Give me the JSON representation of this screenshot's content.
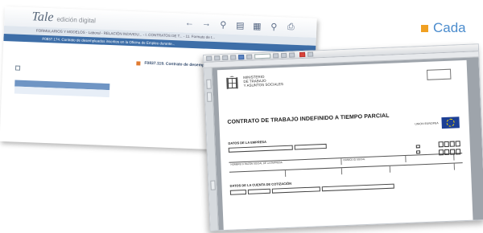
{
  "caption": {
    "text": "Cada"
  },
  "back_window": {
    "logo_mark": "Tale",
    "logo_sub": "edición digital",
    "toolbar_icons": [
      "back-arrow-icon",
      "forward-arrow-icon",
      "search-icon",
      "list-icon",
      "document-icon",
      "search-small-icon",
      "print-icon"
    ],
    "breadcrumb": "FORMULARIOS Y MODELOS - Laboral - RELACIÓN INDIVIDU... - I. CONTRATOS DE T... - 11. Formato de t...",
    "title": "F0837.174. Contrato de desempleados inscritos en la Oficina de Empleo durante...",
    "title_ref": "",
    "sidebar_row1": "",
    "sidebar_row2_a": "",
    "sidebar_row2_b": "",
    "sidebar_section": "",
    "sidebar_date": "",
    "content_heading": "F0837.119. Contrato de desemp...",
    "content_p1": "",
    "content_p2": "",
    "content_p3": ""
  },
  "front_window": {
    "toolbar_text": "",
    "sub_text": "",
    "ministry": [
      "MINISTERIO",
      "DE TRABAJO",
      "Y ASUNTOS SOCIALES"
    ],
    "sepe_label": "",
    "doc_title": "CONTRATO DE TRABAJO INDEFINIDO A TIEMPO PARCIAL",
    "ue_label": "UNION EUROPEA",
    "ue_sub": "",
    "section_company": "DATOS DE LA EMPRESA",
    "check_a": "",
    "check_b": "",
    "section_account": "DATOS DE LA CUENTA DE COTIZACIÓN",
    "grid_labels": [
      "NOMBRE O RAZÓN SOCIAL DE LA EMPRESA",
      "DOMICILIO SOCIAL",
      "",
      "",
      "",
      ""
    ]
  }
}
